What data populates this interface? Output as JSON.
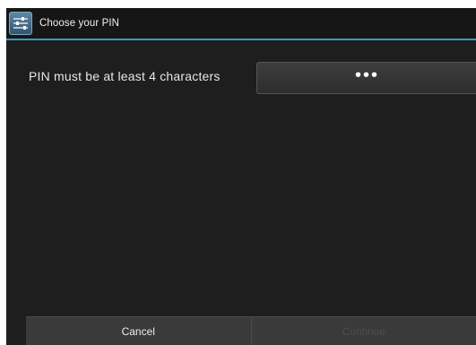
{
  "titlebar": {
    "title": "Choose your PIN",
    "icon": "settings-sliders-icon"
  },
  "form": {
    "pin_label": "PIN must be at least 4 characters",
    "pin_value": "•••"
  },
  "buttons": {
    "cancel_label": "Cancel",
    "continue_label": "Continue"
  },
  "colors": {
    "accent": "#2f9bc4",
    "background": "#1e1e1e"
  }
}
